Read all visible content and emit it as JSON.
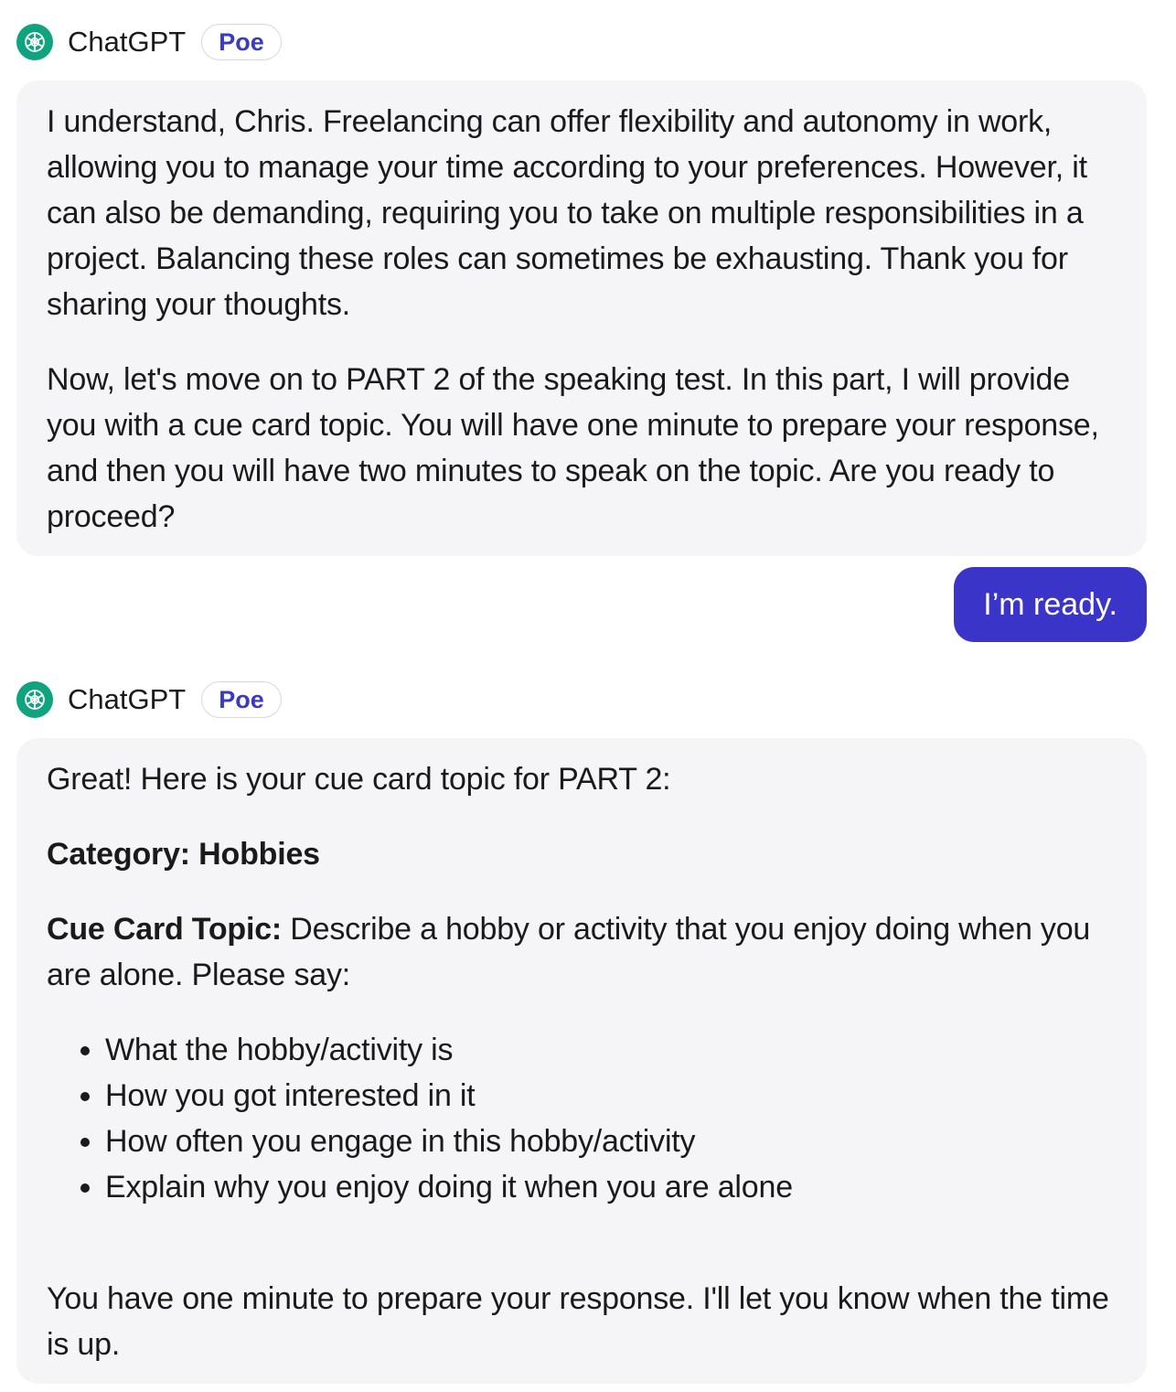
{
  "messages": [
    {
      "sender": "ChatGPT",
      "badge": "Poe",
      "paragraphs": [
        "I understand, Chris. Freelancing can offer flexibility and autonomy in work, allowing you to manage your time according to your preferences. However, it can also be demanding, requiring you to take on multiple responsibilities in a project. Balancing these roles can sometimes be exhausting. Thank you for sharing your thoughts.",
        "Now, let's move on to PART 2 of the speaking test. In this part, I will provide you with a cue card topic. You will have one minute to prepare your response, and then you will have two minutes to speak on the topic. Are you ready to proceed?"
      ]
    },
    {
      "sender": "user",
      "text": "I’m ready."
    },
    {
      "sender": "ChatGPT",
      "badge": "Poe",
      "intro": "Great! Here is your cue card topic for PART 2:",
      "category": "Category: Hobbies",
      "cue_label": "Cue Card Topic:",
      "cue_text": " Describe a hobby or activity that you enjoy doing when you are alone. Please say:",
      "bullets": [
        "What the hobby/activity is",
        "How you got interested in it",
        "How often you engage in this hobby/activity",
        "Explain why you enjoy doing it when you are alone"
      ],
      "closing": "You have one minute to prepare your response. I'll let you know when the time is up."
    }
  ],
  "colors": {
    "bot_bubble_bg": "#f5f5f7",
    "user_bubble_bg": "#3a34c8",
    "badge_text": "#3a3ac4",
    "avatar_bg": "#10a37f"
  },
  "icons": {
    "avatar": "openai-logo-icon"
  }
}
